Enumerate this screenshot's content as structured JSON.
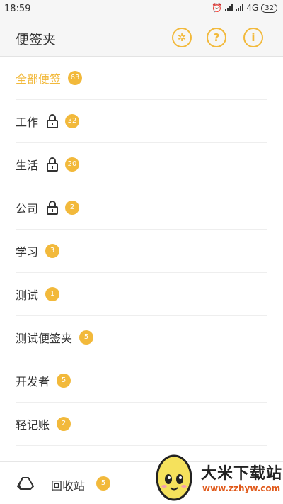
{
  "status": {
    "time": "18:59",
    "network": "4G",
    "battery": "32"
  },
  "header": {
    "title": "便签夹",
    "icons": [
      "settings-icon",
      "help-icon",
      "info-icon"
    ],
    "settings_glyph": "✲",
    "help_glyph": "?",
    "info_glyph": "i"
  },
  "folders": [
    {
      "label": "全部便签",
      "count": "63",
      "locked": false,
      "active": true
    },
    {
      "label": "工作",
      "count": "32",
      "locked": true,
      "active": false
    },
    {
      "label": "生活",
      "count": "20",
      "locked": true,
      "active": false
    },
    {
      "label": "公司",
      "count": "2",
      "locked": true,
      "active": false
    },
    {
      "label": "学习",
      "count": "3",
      "locked": false,
      "active": false
    },
    {
      "label": "测试",
      "count": "1",
      "locked": false,
      "active": false
    },
    {
      "label": "测试便签夹",
      "count": "5",
      "locked": false,
      "active": false
    },
    {
      "label": "开发者",
      "count": "5",
      "locked": false,
      "active": false
    },
    {
      "label": "轻记账",
      "count": "2",
      "locked": false,
      "active": false
    }
  ],
  "bottom": {
    "label": "回收站",
    "count": "5"
  },
  "watermark": {
    "title": "大米下载站",
    "url": "www.zzhyw.com"
  },
  "colors": {
    "accent": "#f2b93b",
    "text": "#333333"
  }
}
